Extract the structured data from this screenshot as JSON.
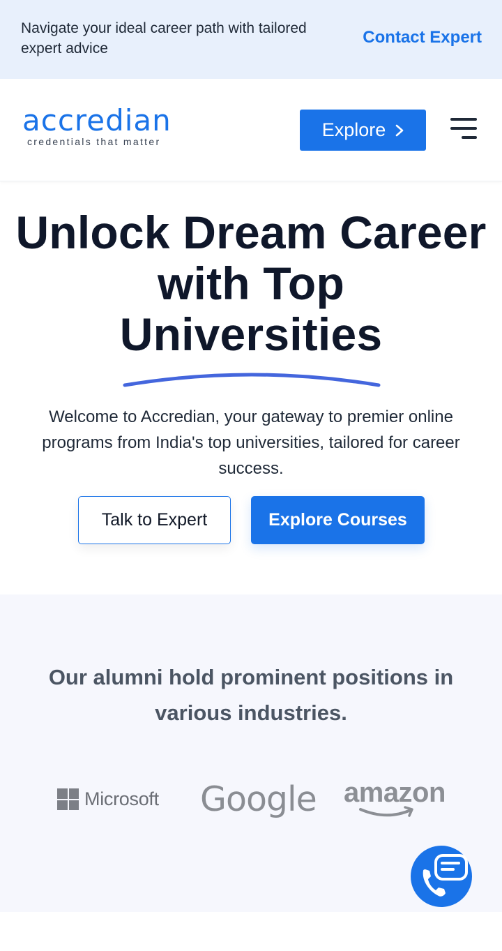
{
  "topbar": {
    "message": "Navigate your ideal career path with tailored expert advice",
    "contact_label": "Contact Expert"
  },
  "header": {
    "logo_brand": "accredian",
    "logo_tagline": "credentials that matter",
    "explore_label": "Explore"
  },
  "hero": {
    "title_line1": "Unlock Dream Career",
    "title_line2": "with Top",
    "title_line3": "Universities",
    "subtitle": "Welcome to Accredian, your gateway to premier online programs from India's top universities, tailored for career success.",
    "talk_label": "Talk to Expert",
    "explore_courses_label": "Explore Courses"
  },
  "alumni": {
    "heading": "Our alumni hold prominent positions in various industries.",
    "companies": [
      "Microsoft",
      "Google",
      "amazon"
    ]
  },
  "colors": {
    "accent": "#1a73e8",
    "banner_bg": "#e8f0fc",
    "section_bg": "#f6f7fd",
    "underline": "#4466dd"
  },
  "icons": {
    "explore_chevron": "chevron-right-icon",
    "menu": "hamburger-menu-icon",
    "fab": "chat-call-icon",
    "microsoft": "microsoft-logo-icon"
  }
}
